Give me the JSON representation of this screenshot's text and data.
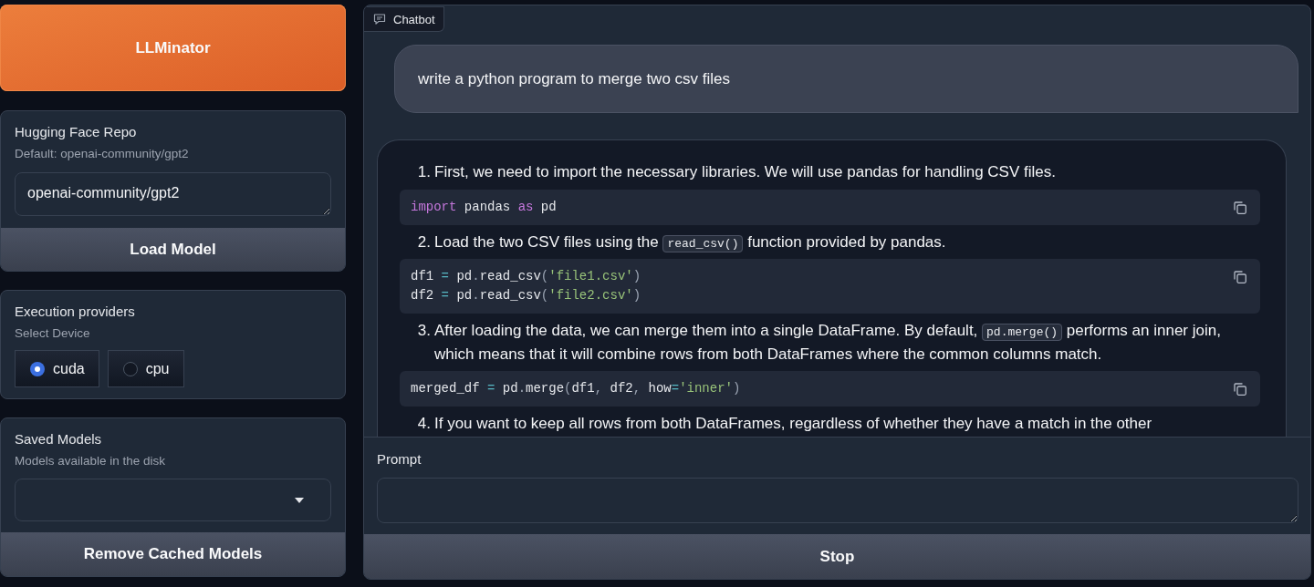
{
  "app_button": {
    "label": "LLMinator"
  },
  "repo_panel": {
    "label": "Hugging Face Repo",
    "info": "Default: openai-community/gpt2",
    "value": "openai-community/gpt2",
    "button": "Load Model"
  },
  "providers_panel": {
    "label": "Execution providers",
    "info": "Select Device",
    "options": [
      {
        "label": "cuda",
        "selected": true
      },
      {
        "label": "cpu",
        "selected": false
      }
    ]
  },
  "saved_models_panel": {
    "label": "Saved Models",
    "info": "Models available in the disk",
    "button": "Remove Cached Models"
  },
  "chatbot": {
    "label": "Chatbot",
    "messages": [
      {
        "kind": "user",
        "text": "write a python program to merge two csv files"
      },
      {
        "kind": "bot",
        "blocks": [
          {
            "kind": "list_item",
            "number": "1.",
            "parts": [
              {
                "kind": "text",
                "text": "First, we need to import the necessary libraries. We will use pandas for handling CSV files."
              }
            ]
          },
          {
            "kind": "code",
            "lines": [
              [
                {
                  "kind": "keyword",
                  "text": "import"
                },
                {
                  "kind": "plain",
                  "text": " pandas "
                },
                {
                  "kind": "keyword",
                  "text": "as"
                },
                {
                  "kind": "plain",
                  "text": " pd"
                }
              ]
            ]
          },
          {
            "kind": "list_item",
            "number": "2.",
            "parts": [
              {
                "kind": "text",
                "text": "Load the two CSV files using the "
              },
              {
                "kind": "code",
                "text": "read_csv()"
              },
              {
                "kind": "text",
                "text": " function provided by pandas."
              }
            ]
          },
          {
            "kind": "code",
            "lines": [
              [
                {
                  "kind": "plain",
                  "text": "df1 "
                },
                {
                  "kind": "operator",
                  "text": "="
                },
                {
                  "kind": "plain",
                  "text": " pd"
                },
                {
                  "kind": "punct",
                  "text": "."
                },
                {
                  "kind": "plain",
                  "text": "read_csv"
                },
                {
                  "kind": "punct",
                  "text": "("
                },
                {
                  "kind": "string",
                  "text": "'file1.csv'"
                },
                {
                  "kind": "punct",
                  "text": ")"
                }
              ],
              [
                {
                  "kind": "plain",
                  "text": "df2 "
                },
                {
                  "kind": "operator",
                  "text": "="
                },
                {
                  "kind": "plain",
                  "text": " pd"
                },
                {
                  "kind": "punct",
                  "text": "."
                },
                {
                  "kind": "plain",
                  "text": "read_csv"
                },
                {
                  "kind": "punct",
                  "text": "("
                },
                {
                  "kind": "string",
                  "text": "'file2.csv'"
                },
                {
                  "kind": "punct",
                  "text": ")"
                }
              ]
            ]
          },
          {
            "kind": "list_item",
            "number": "3.",
            "parts": [
              {
                "kind": "text",
                "text": "After loading the data, we can merge them into a single DataFrame. By default, "
              },
              {
                "kind": "code",
                "text": "pd.merge()"
              },
              {
                "kind": "text",
                "text": " performs an inner join, which means that it will combine rows from both DataFrames where the common columns match."
              }
            ]
          },
          {
            "kind": "code",
            "lines": [
              [
                {
                  "kind": "plain",
                  "text": "merged_df "
                },
                {
                  "kind": "operator",
                  "text": "="
                },
                {
                  "kind": "plain",
                  "text": " pd"
                },
                {
                  "kind": "punct",
                  "text": "."
                },
                {
                  "kind": "plain",
                  "text": "merge"
                },
                {
                  "kind": "punct",
                  "text": "("
                },
                {
                  "kind": "plain",
                  "text": "df1"
                },
                {
                  "kind": "punct",
                  "text": ","
                },
                {
                  "kind": "plain",
                  "text": " df2"
                },
                {
                  "kind": "punct",
                  "text": ","
                },
                {
                  "kind": "plain",
                  "text": " how"
                },
                {
                  "kind": "operator",
                  "text": "="
                },
                {
                  "kind": "string",
                  "text": "'inner'"
                },
                {
                  "kind": "punct",
                  "text": ")"
                }
              ]
            ]
          },
          {
            "kind": "list_item",
            "number": "4.",
            "parts": [
              {
                "kind": "text",
                "text": "If you want to keep all rows from both DataFrames, regardless of whether they have a match in the other"
              }
            ]
          }
        ]
      }
    ]
  },
  "prompt": {
    "label": "Prompt",
    "button": "Stop"
  }
}
